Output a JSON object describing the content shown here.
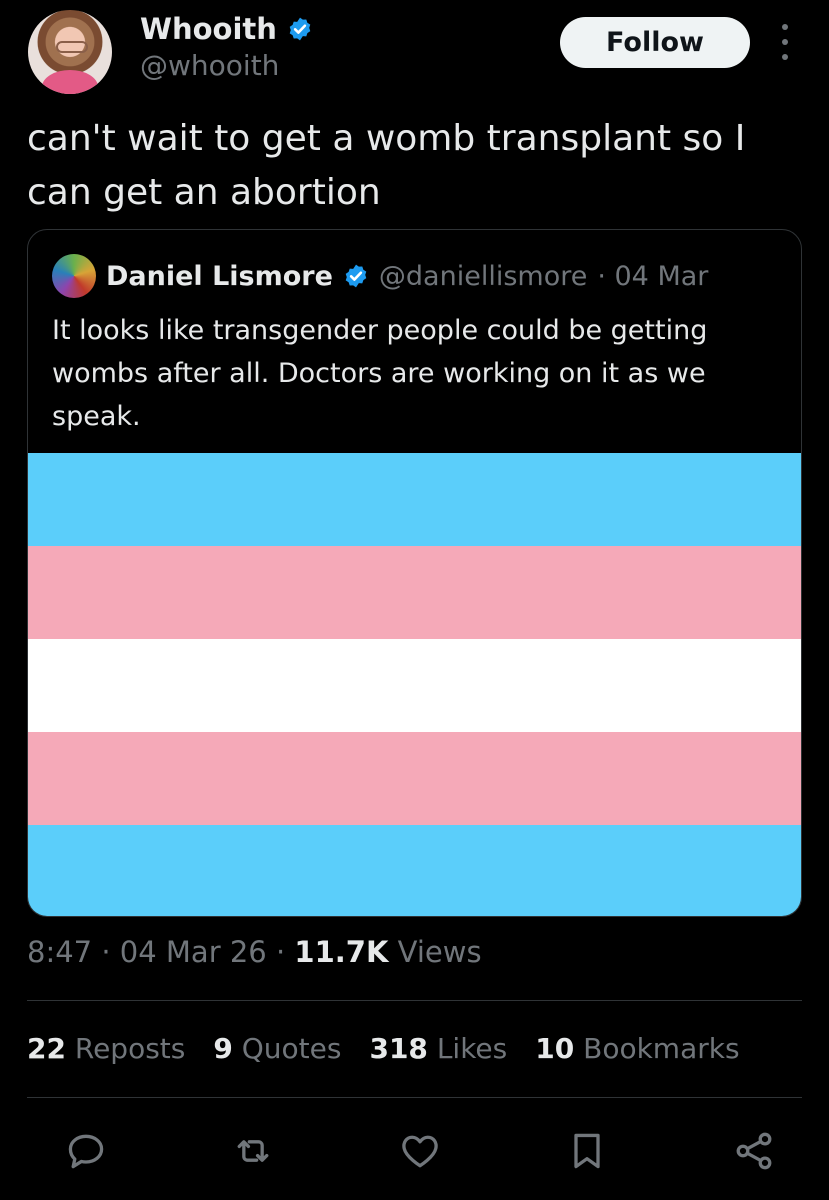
{
  "author": {
    "display_name": "Whooith",
    "handle": "@whooith",
    "verified": true
  },
  "follow_label": "Follow",
  "tweet": {
    "text": "can't wait to get a womb transplant so I can get an abortion"
  },
  "quoted_tweet": {
    "display_name": "Daniel Lismore",
    "handle": "@daniellismore",
    "date": "· 04 Mar",
    "verified": true,
    "text": "It looks like transgender people could be getting wombs after all. Doctors are working on it as we speak.",
    "image": {
      "type": "flag",
      "stripe_colors": [
        "#5bcefa",
        "#f5a9b8",
        "#ffffff",
        "#f5a9b8",
        "#5bcefa"
      ]
    }
  },
  "meta": {
    "time": "8:47",
    "date": "· 04 Mar 26 ·",
    "views_count": "11.7K",
    "views_label": "Views"
  },
  "stats": [
    {
      "count": "22",
      "label": "Reposts"
    },
    {
      "count": "9",
      "label": "Quotes"
    },
    {
      "count": "318",
      "label": "Likes"
    },
    {
      "count": "10",
      "label": "Bookmarks"
    }
  ],
  "colors": {
    "background": "#000000",
    "text": "#e7e9ea",
    "secondary_text": "#71767b",
    "verified_blue": "#1d9bf0",
    "divider": "#2f3336"
  },
  "actions": [
    "reply-icon",
    "repost-icon",
    "like-icon",
    "bookmark-icon",
    "share-icon"
  ]
}
